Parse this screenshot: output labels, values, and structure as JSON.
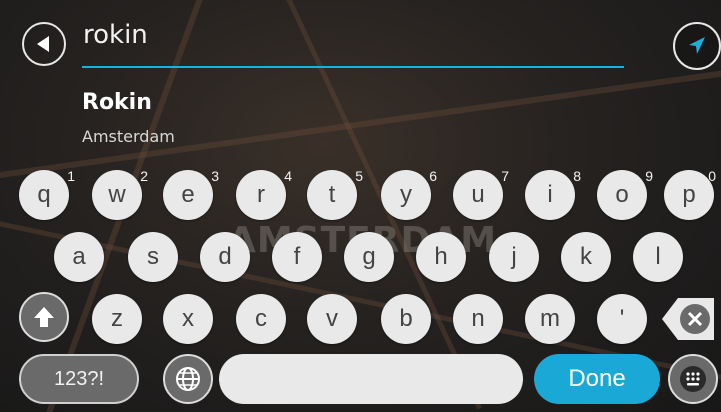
{
  "search": {
    "value": "rokin"
  },
  "result": {
    "title": "Rokin",
    "subtitle": "Amsterdam"
  },
  "map_labels": {
    "city": "AMSTERDAM"
  },
  "keyboard": {
    "row1": [
      {
        "label": "q",
        "sup": "1"
      },
      {
        "label": "w",
        "sup": "2"
      },
      {
        "label": "e",
        "sup": "3"
      },
      {
        "label": "r",
        "sup": "4"
      },
      {
        "label": "t",
        "sup": "5"
      },
      {
        "label": "y",
        "sup": "6"
      },
      {
        "label": "u",
        "sup": "7"
      },
      {
        "label": "i",
        "sup": "8"
      },
      {
        "label": "o",
        "sup": "9"
      },
      {
        "label": "p",
        "sup": "0"
      }
    ],
    "row2": [
      "a",
      "s",
      "d",
      "f",
      "g",
      "h",
      "j",
      "k",
      "l"
    ],
    "row3": [
      "z",
      "x",
      "c",
      "v",
      "b",
      "n",
      "m",
      "'"
    ],
    "numbers_label": "123?!",
    "done_label": "Done"
  },
  "colors": {
    "accent": "#1aa9d6",
    "key": "#e9e9e9"
  },
  "icons": {
    "back": "arrow-left-icon",
    "navigate": "navigation-arrow-icon",
    "shift": "shift-arrow-icon",
    "backspace": "backspace-icon",
    "language": "globe-icon",
    "keyboard_switch": "keyboard-icon"
  }
}
